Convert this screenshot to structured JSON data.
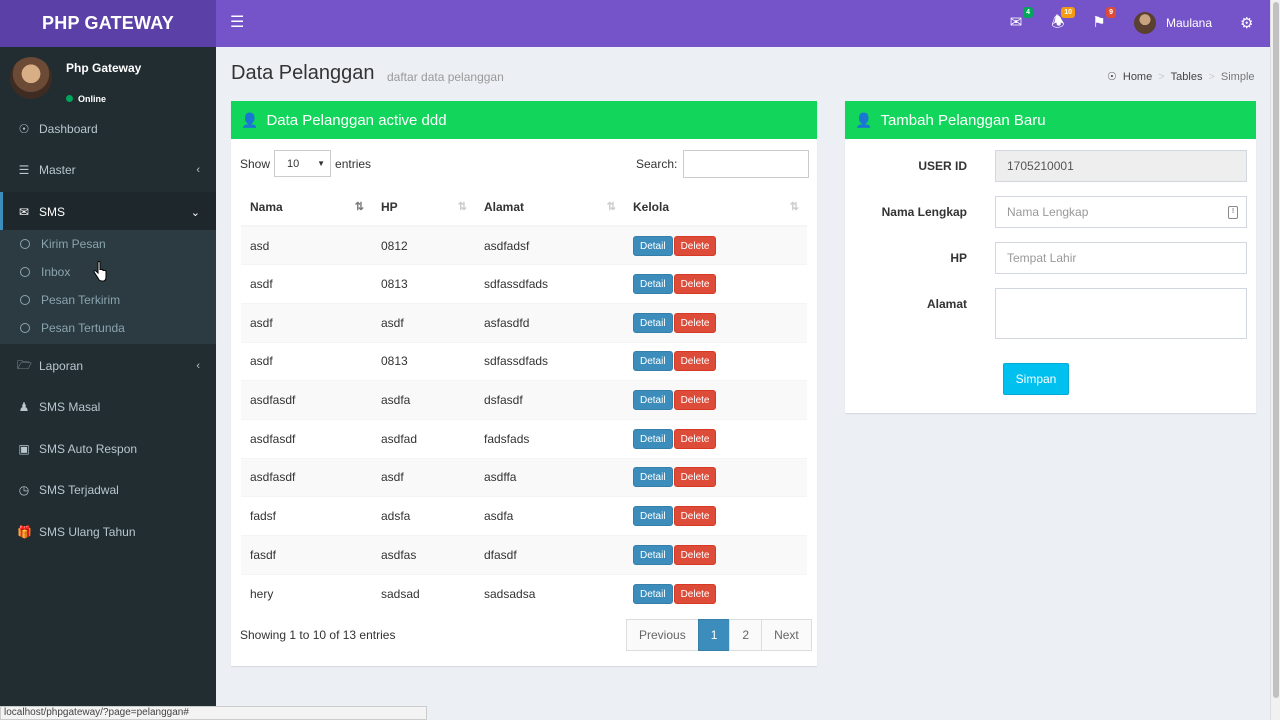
{
  "header": {
    "logo": "PHP GATEWAY",
    "toggle_icon": "hamburger-icon",
    "notifications": [
      {
        "icon": "envelope-icon",
        "count": "4",
        "color": "#00a65a"
      },
      {
        "icon": "bell-icon",
        "count": "10",
        "color": "#f39c12"
      },
      {
        "icon": "flag-icon",
        "count": "9",
        "color": "#dd4b39"
      }
    ],
    "user_name": "Maulana"
  },
  "sidebar": {
    "user": {
      "name": "Php Gateway",
      "status": "Online"
    },
    "items": [
      {
        "label": "Dashboard",
        "icon": "dashboard-icon"
      },
      {
        "label": "Master",
        "icon": "bars-icon",
        "caret": "‹"
      },
      {
        "label": "SMS",
        "icon": "envelope-icon",
        "caret": "⌄"
      },
      {
        "label": "Laporan",
        "icon": "folder-icon",
        "caret": "‹"
      },
      {
        "label": "SMS Masal",
        "icon": "users-icon"
      },
      {
        "label": "SMS Auto Respon",
        "icon": "window-icon"
      },
      {
        "label": "SMS Terjadwal",
        "icon": "clock-icon"
      },
      {
        "label": "SMS Ulang Tahun",
        "icon": "gift-icon"
      }
    ],
    "submenu": [
      "Kirim Pesan",
      "Inbox",
      "Pesan Terkirim",
      "Pesan Tertunda"
    ]
  },
  "content": {
    "title": "Data Pelanggan",
    "subtitle": "daftar data pelanggan",
    "breadcrumb": [
      "Home",
      "Tables",
      "Simple"
    ]
  },
  "table_box": {
    "title": "Data Pelanggan active ddd",
    "show_label": "Show",
    "entries_value": "10",
    "entries_label": "entries",
    "search_label": "Search:",
    "columns": [
      "Nama",
      "HP",
      "Alamat",
      "Kelola"
    ],
    "rows": [
      [
        "asd",
        "0812",
        "asdfadsf"
      ],
      [
        "asdf",
        "0813",
        "sdfassdfads"
      ],
      [
        "asdf",
        "asdf",
        "asfasdfd"
      ],
      [
        "asdf",
        "0813",
        "sdfassdfads"
      ],
      [
        "asdfasdf",
        "asdfa",
        "dsfasdf"
      ],
      [
        "asdfasdf",
        "asdfad",
        "fadsfads"
      ],
      [
        "asdfasdf",
        "asdf",
        "asdffa"
      ],
      [
        "fadsf",
        "adsfa",
        "asdfa"
      ],
      [
        "fasdf",
        "asdfas",
        "dfasdf"
      ],
      [
        "hery",
        "sadsad",
        "sadsadsa"
      ]
    ],
    "detail_label": "Detail",
    "delete_label": "Delete",
    "info": "Showing 1 to 10 of 13 entries",
    "pagination": [
      "Previous",
      "1",
      "2",
      "Next"
    ]
  },
  "form_box": {
    "title": "Tambah Pelanggan Baru",
    "fields": [
      {
        "label": "USER ID",
        "value": "1705210001",
        "placeholder": ""
      },
      {
        "label": "Nama Lengkap",
        "value": "",
        "placeholder": "Nama Lengkap"
      },
      {
        "label": "HP",
        "value": "",
        "placeholder": "Tempat Lahir"
      },
      {
        "label": "Alamat",
        "value": "",
        "placeholder": ""
      }
    ],
    "submit": "Simpan"
  },
  "status_bar": "localhost/phpgateway/?page=pelanggan#"
}
